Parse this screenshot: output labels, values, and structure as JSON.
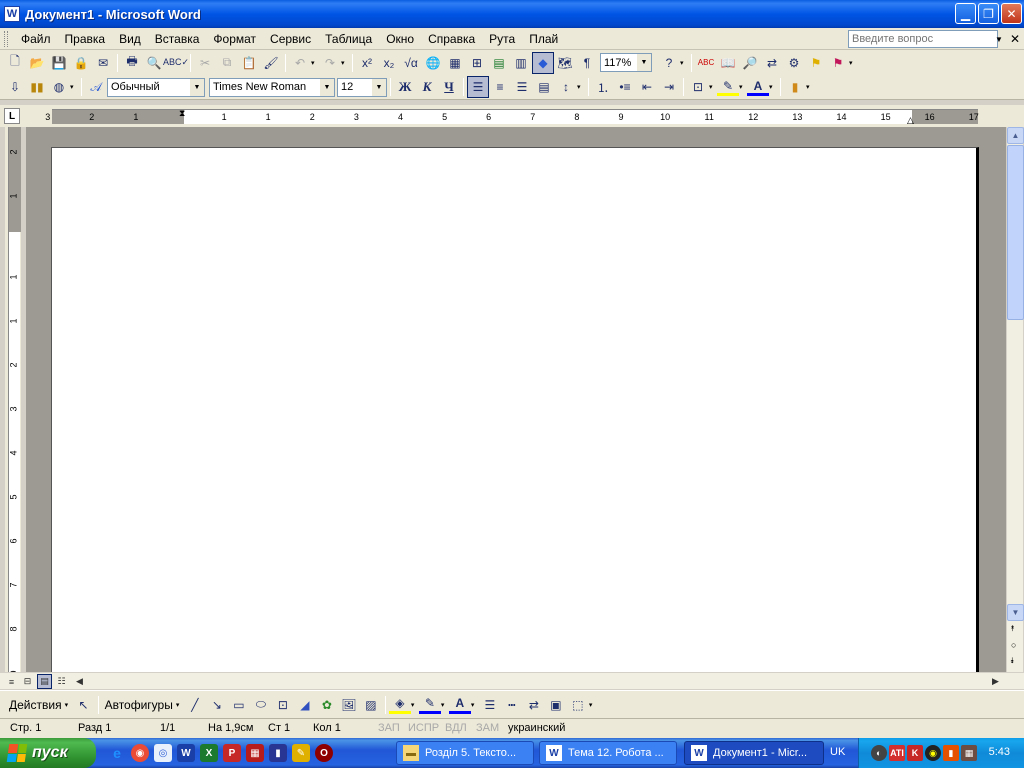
{
  "window": {
    "title": "Документ1 - Microsoft Word",
    "app_icon": "W"
  },
  "menu": {
    "items": [
      "Файл",
      "Правка",
      "Вид",
      "Вставка",
      "Формат",
      "Сервис",
      "Таблица",
      "Окно",
      "Справка",
      "Рута",
      "Плай"
    ],
    "ask_placeholder": "Введите вопрос"
  },
  "toolbar": {
    "zoom": "117%",
    "style": "Обычный",
    "font": "Times New Roman",
    "size": "12",
    "bold": "Ж",
    "italic": "К",
    "underline": "Ч"
  },
  "ruler": {
    "labels": [
      "3",
      "2",
      "1",
      "1",
      "1",
      "2",
      "3",
      "4",
      "5",
      "6",
      "7",
      "8",
      "9",
      "10",
      "11",
      "12",
      "13",
      "14",
      "15",
      "16",
      "17"
    ],
    "vlabels": [
      "2",
      "1",
      "1",
      "1",
      "2",
      "3",
      "4",
      "5",
      "6",
      "7",
      "8",
      "9"
    ],
    "corner": "L"
  },
  "drawing": {
    "actions": "Действия",
    "autoshapes": "Автофигуры"
  },
  "status": {
    "page": "Стр. 1",
    "section": "Разд 1",
    "pages": "1/1",
    "at": "На 1,9см",
    "line": "Ст 1",
    "col": "Кол 1",
    "rec": "ЗАП",
    "trk": "ИСПР",
    "ext": "ВДЛ",
    "ovr": "ЗАМ",
    "language": "украинский"
  },
  "taskbar": {
    "start": "пуск",
    "tasks": [
      {
        "label": "Розділ 5. Тексто...",
        "icon": "folder"
      },
      {
        "label": "Тема 12. Робота ...",
        "icon": "W"
      },
      {
        "label": "Документ1 - Micr...",
        "icon": "W"
      }
    ],
    "lang": "UK",
    "clock": "5:43"
  }
}
